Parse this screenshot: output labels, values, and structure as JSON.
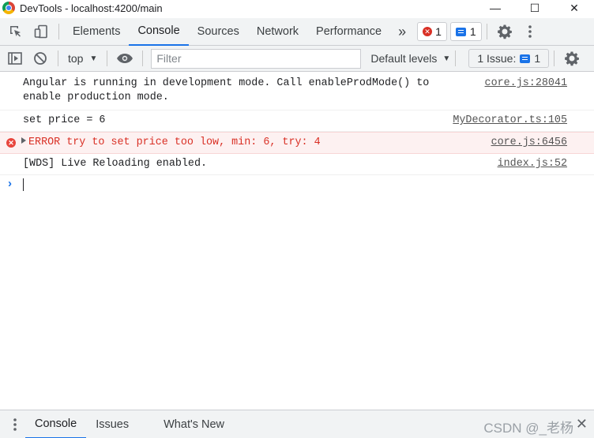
{
  "window": {
    "title": "DevTools - localhost:4200/main",
    "minimize": "—",
    "maximize": "☐",
    "close": "✕"
  },
  "tabs": [
    {
      "label": "Elements"
    },
    {
      "label": "Console"
    },
    {
      "label": "Sources"
    },
    {
      "label": "Network"
    },
    {
      "label": "Performance"
    }
  ],
  "more_tabs": "»",
  "badges": {
    "errors": "1",
    "messages": "1"
  },
  "toolbar": {
    "context": "top",
    "filter_placeholder": "Filter",
    "levels": "Default levels",
    "issues_label": "1 Issue:",
    "issues_count": "1"
  },
  "messages": [
    {
      "text": "Angular is running in development mode. Call enableProdMode() to\nenable production mode.",
      "source": "core.js:28041",
      "level": "log"
    },
    {
      "text": "set price = 6",
      "source": "MyDecorator.ts:105",
      "level": "log"
    },
    {
      "text": "ERROR try to set price too low, min: 6, try: 4",
      "source": "core.js:6456",
      "level": "error"
    },
    {
      "text": "[WDS] Live Reloading enabled.",
      "source": "index.js:52",
      "level": "log"
    }
  ],
  "prompt": "›",
  "drawer": {
    "tabs": [
      {
        "label": "Console"
      },
      {
        "label": "Issues"
      },
      {
        "label": "What's New"
      }
    ],
    "watermark": "CSDN @_老杨",
    "close": "✕"
  },
  "colors": {
    "accent": "#1a73e8",
    "error": "#d93025",
    "error_bg": "#fdf1f1"
  }
}
